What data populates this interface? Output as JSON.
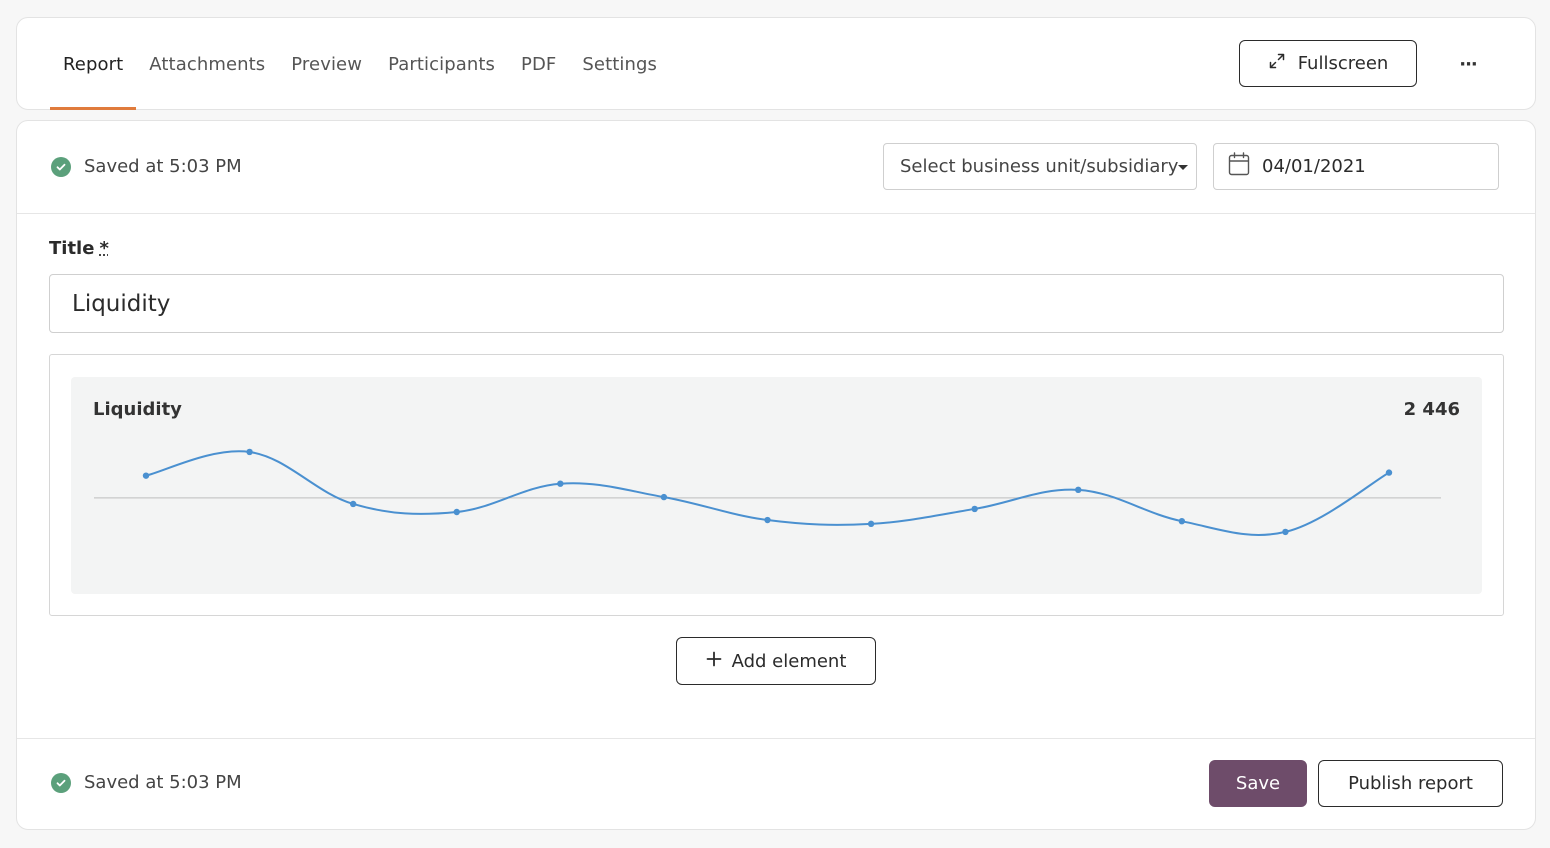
{
  "tabs": [
    {
      "label": "Report",
      "active": true
    },
    {
      "label": "Attachments",
      "active": false
    },
    {
      "label": "Preview",
      "active": false
    },
    {
      "label": "Participants",
      "active": false
    },
    {
      "label": "PDF",
      "active": false
    },
    {
      "label": "Settings",
      "active": false
    }
  ],
  "header": {
    "fullscreen_label": "Fullscreen",
    "fullscreen_icon": "expand-arrows-icon",
    "more_label": "···"
  },
  "toolbar": {
    "status_text": "Saved at 5:03 PM",
    "business_unit_placeholder": "Select business unit/subsidiary",
    "date_value": "04/01/2021"
  },
  "form": {
    "title_label": "Title",
    "required_marker": "*",
    "title_value": "Liquidity"
  },
  "widget": {
    "title": "Liquidity",
    "value": "2 446"
  },
  "chart_data": {
    "type": "line",
    "title": "Liquidity",
    "x": [
      1,
      2,
      3,
      4,
      5,
      6,
      7,
      8,
      9,
      10,
      11,
      12,
      13
    ],
    "values": [
      0.58,
      1.2,
      -0.16,
      -0.37,
      0.37,
      0.02,
      -0.58,
      -0.68,
      -0.29,
      0.21,
      -0.61,
      -0.89,
      0.66
    ],
    "baseline": 0,
    "ylim": [
      -2.2,
      1.8
    ],
    "grid": false,
    "legend": "none",
    "line_color": "#4a90d0",
    "baseline_color": "#c8c8c8"
  },
  "actions": {
    "add_element_label": "Add element",
    "save_label": "Save",
    "publish_label": "Publish report"
  },
  "footer": {
    "status_text": "Saved at 5:03 PM"
  },
  "colors": {
    "accent_tab": "#e07b3c",
    "save_button": "#6e4c6a",
    "saved_check": "#5ba07b"
  }
}
